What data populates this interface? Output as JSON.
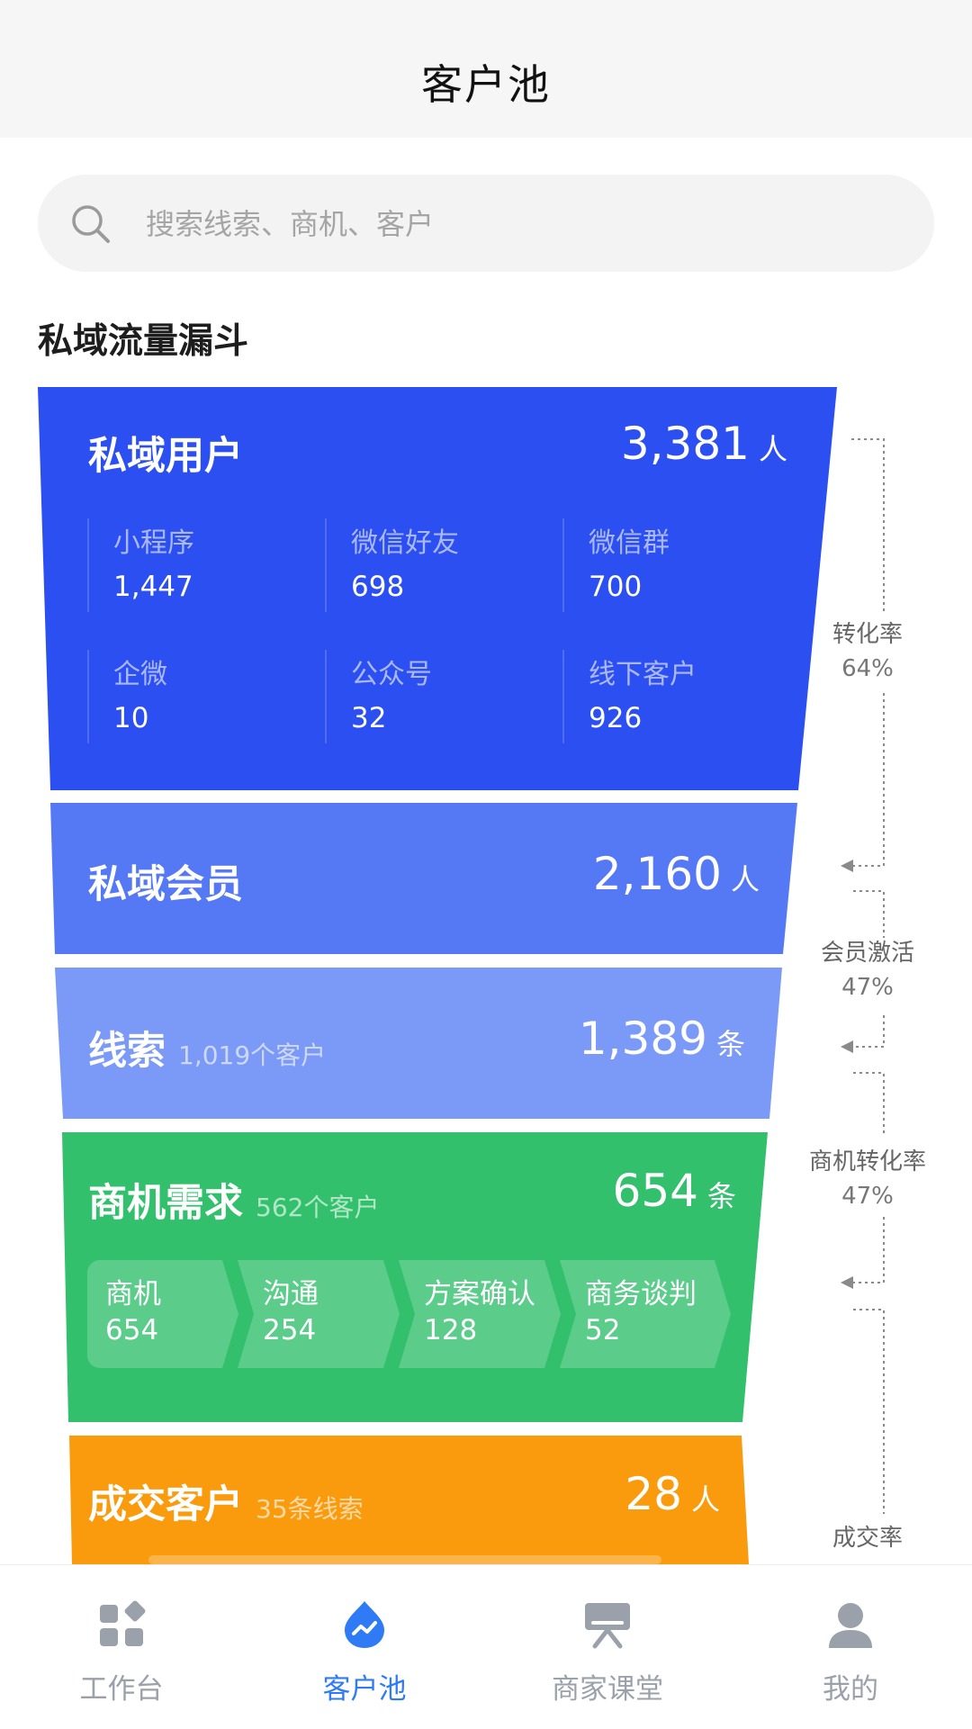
{
  "header": {
    "title": "客户池"
  },
  "search": {
    "placeholder": "搜索线索、商机、客户",
    "icon": "search-icon"
  },
  "section": {
    "title": "私域流量漏斗"
  },
  "colors": {
    "private_users": "#2b4ff0",
    "members": "#5578f5",
    "leads": "#7b9af8",
    "opportunities": "#33c06c",
    "deals": "#fa9b0e",
    "tab_active": "#2f7bf5",
    "tab_inactive": "#9aa1ab"
  },
  "funnel": {
    "private_users": {
      "label": "私域用户",
      "value": "3,381",
      "unit": "人",
      "sources": [
        {
          "name": "小程序",
          "value": "1,447"
        },
        {
          "name": "微信好友",
          "value": "698"
        },
        {
          "name": "微信群",
          "value": "700"
        },
        {
          "name": "企微",
          "value": "10"
        },
        {
          "name": "公众号",
          "value": "32"
        },
        {
          "name": "线下客户",
          "value": "926"
        }
      ]
    },
    "members": {
      "label": "私域会员",
      "value": "2,160",
      "unit": "人"
    },
    "leads": {
      "label": "线索",
      "sub": "1,019个客户",
      "value": "1,389",
      "unit": "条"
    },
    "opportunities": {
      "label": "商机需求",
      "sub": "562个客户",
      "value": "654",
      "unit": "条",
      "stages": [
        {
          "name": "商机",
          "value": "654"
        },
        {
          "name": "沟通",
          "value": "254"
        },
        {
          "name": "方案确认",
          "value": "128"
        },
        {
          "name": "商务谈判",
          "value": "52"
        }
      ]
    },
    "deals": {
      "label": "成交客户",
      "sub": "35条线索",
      "value": "28",
      "unit": "人"
    }
  },
  "rates": [
    {
      "name": "转化率",
      "value": "64%"
    },
    {
      "name": "会员激活",
      "value": "47%"
    },
    {
      "name": "商机转化率",
      "value": "47%"
    },
    {
      "name": "成交率",
      "value": ""
    }
  ],
  "tabs": [
    {
      "label": "工作台",
      "icon": "workbench-icon",
      "active": false
    },
    {
      "label": "客户池",
      "icon": "customer-pool-icon",
      "active": true
    },
    {
      "label": "商家课堂",
      "icon": "classroom-icon",
      "active": false
    },
    {
      "label": "我的",
      "icon": "profile-icon",
      "active": false
    }
  ]
}
